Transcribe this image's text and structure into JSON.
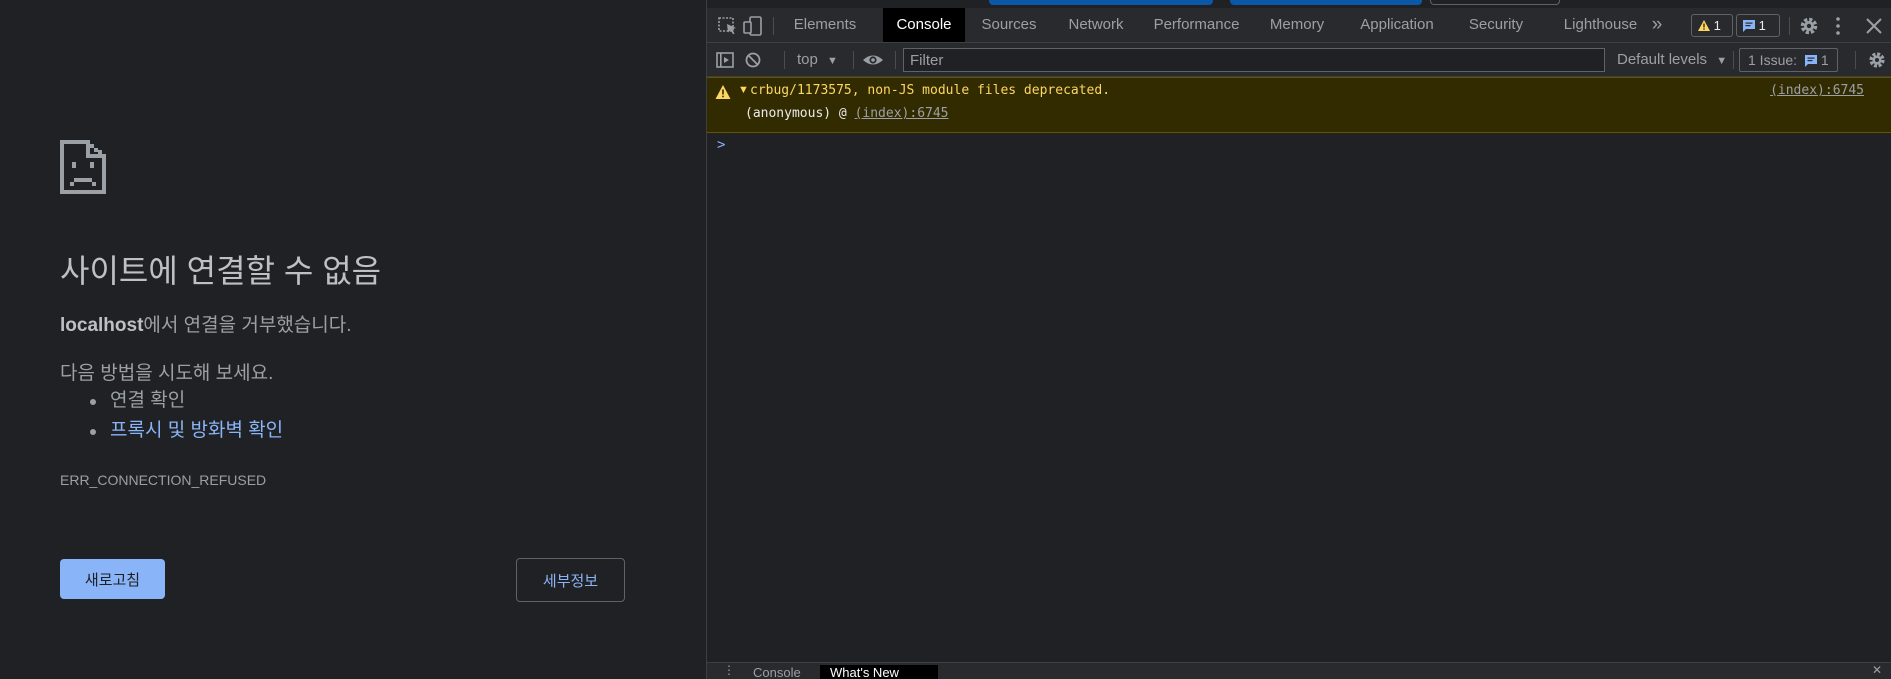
{
  "error_page": {
    "icon": "sad-page-icon",
    "title": "사이트에 연결할 수 없음",
    "host": "localhost",
    "description_suffix": "에서 연결을 거부했습니다.",
    "try_heading": "다음 방법을 시도해 보세요.",
    "suggestions": [
      {
        "label": "연결 확인",
        "is_link": false
      },
      {
        "label": "프록시 및 방화벽 확인",
        "is_link": true
      }
    ],
    "error_code": "ERR_CONNECTION_REFUSED",
    "reload_label": "새로고침",
    "details_label": "세부정보"
  },
  "devtools": {
    "tabs": [
      "Elements",
      "Console",
      "Sources",
      "Network",
      "Performance",
      "Memory",
      "Application",
      "Security",
      "Lighthouse"
    ],
    "active_tab": "Console",
    "more_tabs_glyph": "»",
    "warning_count": "1",
    "message_count": "1",
    "toolbar": {
      "context": "top",
      "filter_placeholder": "Filter",
      "levels": "Default levels",
      "issues_label": "1 Issue:",
      "issues_count": "1"
    },
    "console": {
      "warning_text": "crbug/1173575, non-JS module files deprecated.",
      "warning_source": "(index):6745",
      "stack_fn": "(anonymous)",
      "stack_at": "@",
      "stack_link": "(index):6745",
      "prompt": ">"
    },
    "drawer": {
      "tabs": [
        "Console",
        "What's New"
      ]
    },
    "colors": {
      "accent": "#8ab4f8",
      "warning_bg": "#332b00",
      "warning_text": "#fdd663",
      "strip_blue": "#0b57a8"
    }
  }
}
